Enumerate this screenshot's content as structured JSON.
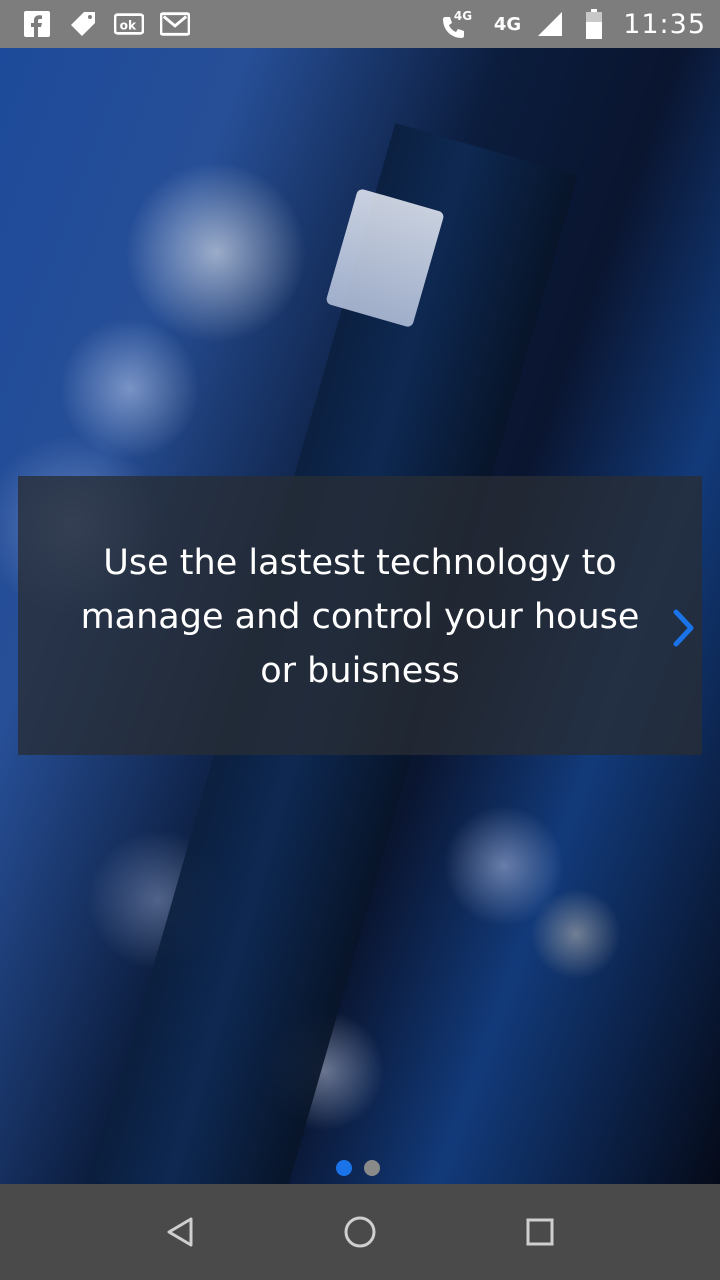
{
  "status_bar": {
    "icons_left": [
      "facebook-icon",
      "tag-icon",
      "vk-icon",
      "gmail-icon"
    ],
    "call_network": "4G",
    "network": "4G",
    "time": "11:35"
  },
  "onboarding": {
    "caption": "Use the lastest technology to manage and control your house or buisness",
    "next_icon": "chevron-right-icon",
    "page_indicator": {
      "total": 2,
      "active": 1
    },
    "colors": {
      "accent": "#1a73e8",
      "dot_inactive": "#8a8a8a",
      "caption_bg": "#282d34"
    }
  },
  "navigation_bar": {
    "icons": [
      "back-icon",
      "home-icon",
      "recents-icon"
    ]
  }
}
